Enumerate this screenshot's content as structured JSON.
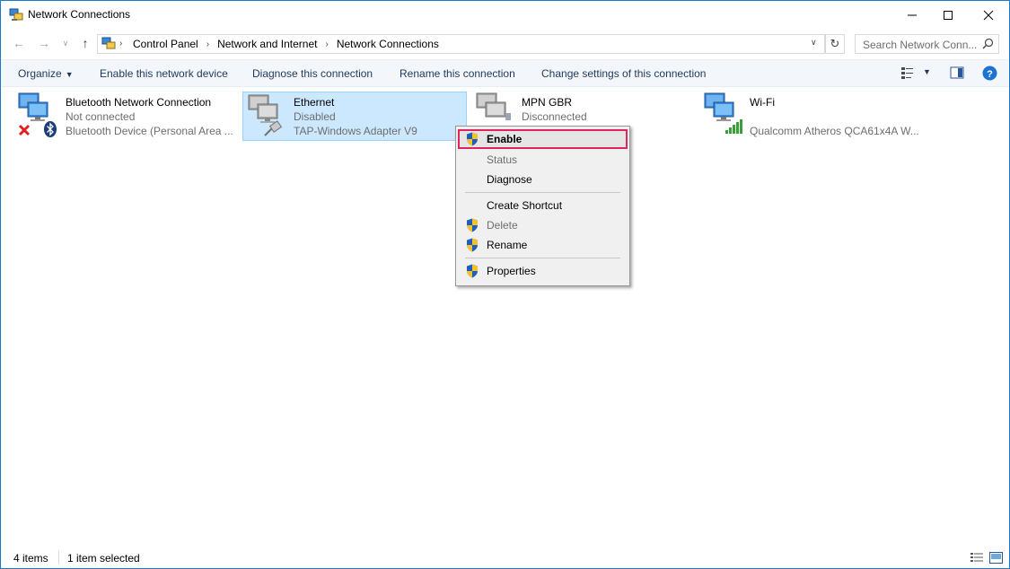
{
  "window": {
    "title": "Network Connections",
    "minimize_icon": "minimize-icon",
    "maximize_icon": "maximize-icon",
    "close_icon": "close-icon"
  },
  "address": {
    "breadcrumbs": [
      "Control Panel",
      "Network and Internet",
      "Network Connections"
    ],
    "search_placeholder": "Search Network Conn..."
  },
  "commands": {
    "organize": "Organize",
    "enable": "Enable this network device",
    "diagnose": "Diagnose this connection",
    "rename": "Rename this connection",
    "change": "Change settings of this connection"
  },
  "connections": [
    {
      "name": "Bluetooth Network Connection",
      "status": "Not connected",
      "device": "Bluetooth Device (Personal Area ...",
      "badge": "red-x-icon",
      "selected": false
    },
    {
      "name": "Ethernet",
      "status": "Disabled",
      "device": "TAP-Windows Adapter V9",
      "badge": "cable-icon",
      "selected": true
    },
    {
      "name": "MPN GBR",
      "status": "Disconnected",
      "device": "",
      "badge": "",
      "selected": false
    },
    {
      "name": "Wi-Fi",
      "status": "",
      "device": "Qualcomm Atheros QCA61x4A W...",
      "badge": "signal-bars-icon",
      "selected": false
    }
  ],
  "context_menu": {
    "enable": "Enable",
    "status": "Status",
    "diagnose": "Diagnose",
    "create_shortcut": "Create Shortcut",
    "delete": "Delete",
    "rename": "Rename",
    "properties": "Properties"
  },
  "status": {
    "items": "4 items",
    "selected": "1 item selected"
  },
  "colors": {
    "selection": "#cce8ff",
    "highlight_border": "#e0245e",
    "command_text": "#1e395b"
  }
}
